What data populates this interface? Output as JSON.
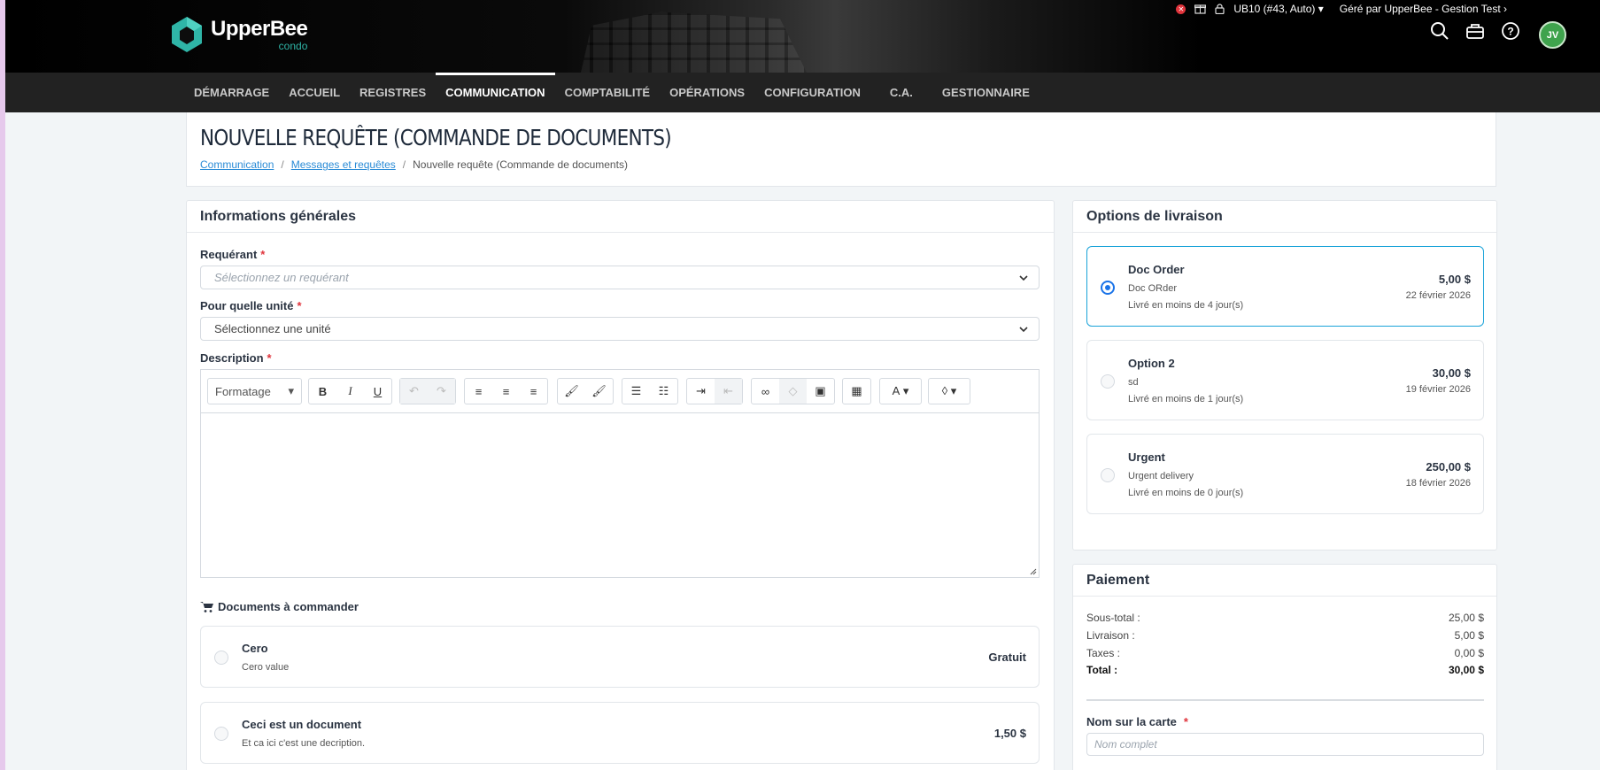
{
  "header": {
    "logo_name": "UpperBee",
    "logo_sub": "condo",
    "unit_selector": "UB10 (#43, Auto)",
    "managed_by_label": "Géré par",
    "managed_by": "UpperBee - Gestion Test",
    "avatar_initials": "JV"
  },
  "nav": {
    "items": [
      "DÉMARRAGE",
      "ACCUEIL",
      "REGISTRES",
      "COMMUNICATION",
      "COMPTABILITÉ",
      "OPÉRATIONS",
      "CONFIGURATION",
      "C.A.",
      "GESTIONNAIRE"
    ],
    "active": "COMMUNICATION"
  },
  "page": {
    "title": "NOUVELLE REQUÊTE (COMMANDE DE DOCUMENTS)",
    "breadcrumb": [
      "Communication",
      "Messages et requêtes",
      "Nouvelle requête (Commande de documents)"
    ]
  },
  "general": {
    "heading": "Informations générales",
    "requester_label": "Requérant",
    "requester_placeholder": "Sélectionnez un requérant",
    "unit_label": "Pour quelle unité",
    "unit_value": "Sélectionnez une unité",
    "description_label": "Description",
    "format_label": "Formatage",
    "documents_heading": "Documents à commander",
    "documents": [
      {
        "title": "Cero",
        "sub": "Cero value",
        "price": "Gratuit"
      },
      {
        "title": "Ceci est un document",
        "sub": "Et ca ici c'est une decription.",
        "price": "1,50 $"
      }
    ]
  },
  "delivery": {
    "heading": "Options de livraison",
    "options": [
      {
        "title": "Doc Order",
        "sub": "Doc ORder",
        "eta": "Livré en moins de 4 jour(s)",
        "price": "5,00 $",
        "date": "22 février 2026",
        "selected": true
      },
      {
        "title": "Option 2",
        "sub": "sd",
        "eta": "Livré en moins de 1 jour(s)",
        "price": "30,00 $",
        "date": "19 février 2026",
        "selected": false
      },
      {
        "title": "Urgent",
        "sub": "Urgent delivery",
        "eta": "Livré en moins de 0 jour(s)",
        "price": "250,00 $",
        "date": "18 février 2026",
        "selected": false
      }
    ]
  },
  "payment": {
    "heading": "Paiement",
    "rows": [
      {
        "label": "Sous-total :",
        "value": "25,00 $"
      },
      {
        "label": "Livraison :",
        "value": "5,00 $"
      },
      {
        "label": "Taxes :",
        "value": "0,00 $"
      }
    ],
    "total_label": "Total :",
    "total_value": "30,00 $",
    "card_name_label": "Nom sur la carte",
    "card_name_placeholder": "Nom complet"
  },
  "colors": {
    "accent": "#1a73e8",
    "brand": "#2fb5a7",
    "required": "#e0343c"
  }
}
